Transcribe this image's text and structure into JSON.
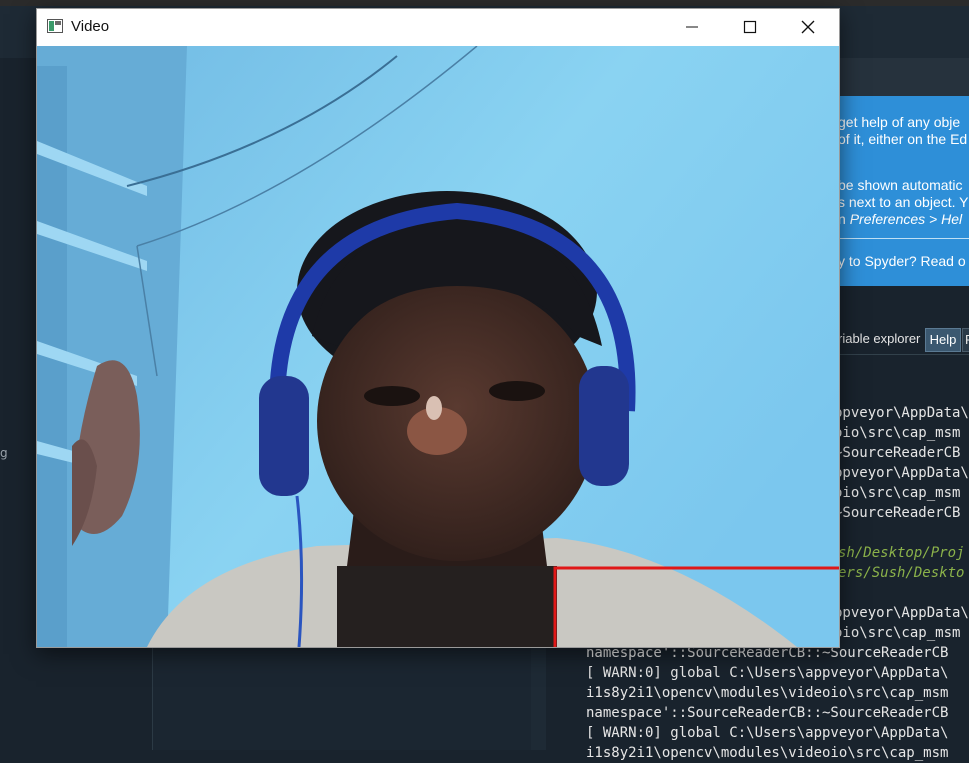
{
  "window": {
    "title": "Video",
    "icon": "opencv-window-icon",
    "controls": {
      "minimize": "minimize-icon",
      "maximize": "maximize-icon",
      "close": "close-icon"
    }
  },
  "ide": {
    "left_glyph": "g",
    "help_panel": {
      "line1": "get help of any obje",
      "line2": "of it, either on the Ed",
      "line3": "be shown automatic",
      "line4": "s next to an object. Y",
      "line5_prefix": "n ",
      "line5_em": "Preferences > Hel",
      "line6": "y to Spyder? Read o"
    },
    "tabs": {
      "variable_explorer": "riable explorer",
      "help": "Help",
      "plots": "P"
    },
    "console_lines": [
      "ppveyor\\AppData\\",
      "oio\\src\\cap_msm",
      "~SourceReaderCB",
      "ppveyor\\AppData\\",
      "oio\\src\\cap_msm",
      "~SourceReaderCB",
      "",
      "sh/Desktop/Proj",
      "ers/Sush/Deskto",
      "",
      "ppveyor\\AppData\\",
      "oio\\src\\cap_msm",
      "namespace'::SourceReaderCB::~SourceReaderCB",
      "[ WARN:0] global C:\\Users\\appveyor\\AppData\\",
      "i1s8y2i1\\opencv\\modules\\videoio\\src\\cap_msm",
      "namespace'::SourceReaderCB::~SourceReaderCB",
      "[ WARN:0] global C:\\Users\\appveyor\\AppData\\",
      "i1s8y2i1\\opencv\\modules\\videoio\\src\\cap_msm"
    ]
  },
  "colors": {
    "ide_bg": "#19232d",
    "help_blue": "#2e8fd8",
    "path_green": "#8bb24a",
    "detection_box": "#e01818"
  }
}
